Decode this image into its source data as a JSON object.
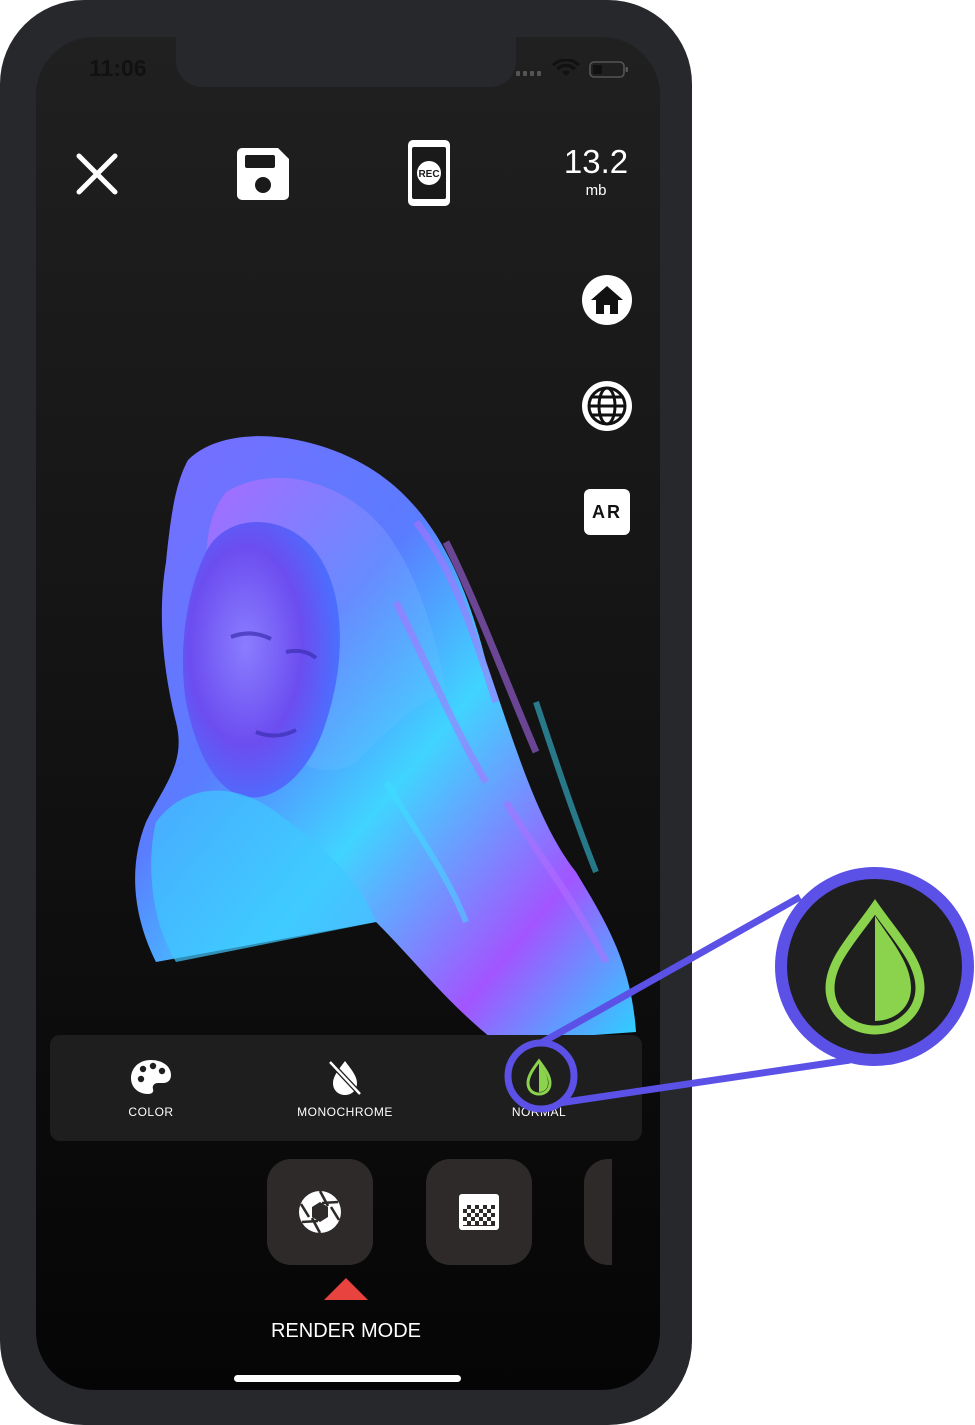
{
  "status_bar": {
    "time": "11:06"
  },
  "toolbar": {
    "file_size": "13.2",
    "file_size_unit": "mb"
  },
  "side_actions": {
    "ar_label": "AR"
  },
  "render_modes": [
    {
      "label": "COLOR",
      "icon": "palette-icon"
    },
    {
      "label": "MONOCHROME",
      "icon": "no-color-drop-icon"
    },
    {
      "label": "NORMAL",
      "icon": "half-drop-icon",
      "selected": true
    }
  ],
  "bottom_bar": {
    "label": "RENDER MODE",
    "indicator_color": "#e8433f"
  },
  "colors": {
    "highlight": "#5b51e6",
    "accent_green": "#8bd34c"
  }
}
